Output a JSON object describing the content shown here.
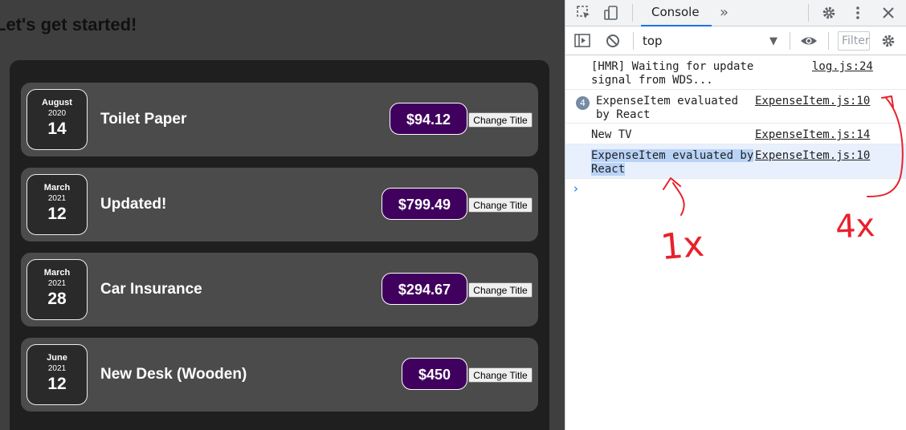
{
  "app": {
    "heading": "Let's get started!",
    "change_title_label": "Change Title",
    "expenses": [
      {
        "month": "August",
        "year": "2020",
        "day": "14",
        "title": "Toilet Paper",
        "amount": "$94.12"
      },
      {
        "month": "March",
        "year": "2021",
        "day": "12",
        "title": "Updated!",
        "amount": "$799.49"
      },
      {
        "month": "March",
        "year": "2021",
        "day": "28",
        "title": "Car Insurance",
        "amount": "$294.67"
      },
      {
        "month": "June",
        "year": "2021",
        "day": "12",
        "title": "New Desk (Wooden)",
        "amount": "$450"
      }
    ]
  },
  "devtools": {
    "tab_label": "Console",
    "more_tabs_icon": "»",
    "context": "top",
    "filter_placeholder": "Filter",
    "icons": [
      "inspect-icon",
      "device-toggle-icon",
      "settings-icon",
      "more-menu-icon",
      "close-icon",
      "sidebar-toggle-icon",
      "clear-console-icon",
      "eye-icon"
    ],
    "logs": [
      {
        "message": "[HMR] Waiting for update signal from WDS...",
        "source": "log.js:24"
      },
      {
        "count": "4",
        "message": "ExpenseItem evaluated by React",
        "source": "ExpenseItem.js:10"
      },
      {
        "message": "New TV",
        "source": "ExpenseItem.js:14"
      },
      {
        "message": "ExpenseItem evaluated by React",
        "source": "ExpenseItem.js:10"
      }
    ],
    "prompt": "›"
  },
  "annotations": {
    "left": "1x",
    "right": "4x",
    "color": "#e8212b"
  }
}
